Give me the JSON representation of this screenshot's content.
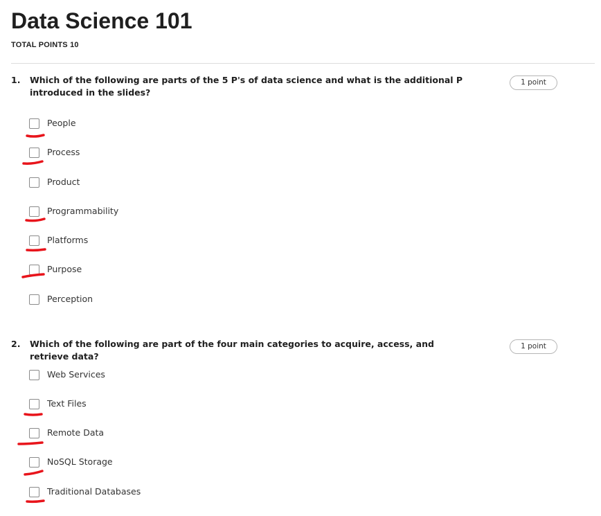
{
  "page": {
    "title": "Data Science 101",
    "total_points": "TOTAL POINTS 10"
  },
  "questions": [
    {
      "number": "1.",
      "text": "Which of the following are parts of the 5 P's of data science and what is the additional P introduced in the slides?",
      "points": "1 point",
      "options": [
        {
          "label": "People",
          "checked": false,
          "annotated": true
        },
        {
          "label": "Process",
          "checked": false,
          "annotated": true
        },
        {
          "label": "Product",
          "checked": false,
          "annotated": false
        },
        {
          "label": "Programmability",
          "checked": false,
          "annotated": true
        },
        {
          "label": "Platforms",
          "checked": false,
          "annotated": true
        },
        {
          "label": "Purpose",
          "checked": false,
          "annotated": true
        },
        {
          "label": "Perception",
          "checked": false,
          "annotated": false
        }
      ]
    },
    {
      "number": "2.",
      "text": "Which of the following are part of the four main categories to acquire, access, and retrieve data?",
      "points": "1 point",
      "options": [
        {
          "label": "Web Services",
          "checked": false,
          "annotated": false
        },
        {
          "label": "Text Files",
          "checked": false,
          "annotated": true
        },
        {
          "label": "Remote Data",
          "checked": false,
          "annotated": true
        },
        {
          "label": "NoSQL Storage",
          "checked": false,
          "annotated": true
        },
        {
          "label": "Traditional Databases",
          "checked": false,
          "annotated": true
        }
      ]
    }
  ],
  "colors": {
    "annotation": "#e8141b",
    "checkbox_border": "#8a8a8a",
    "divider": "#dcdcdc"
  }
}
